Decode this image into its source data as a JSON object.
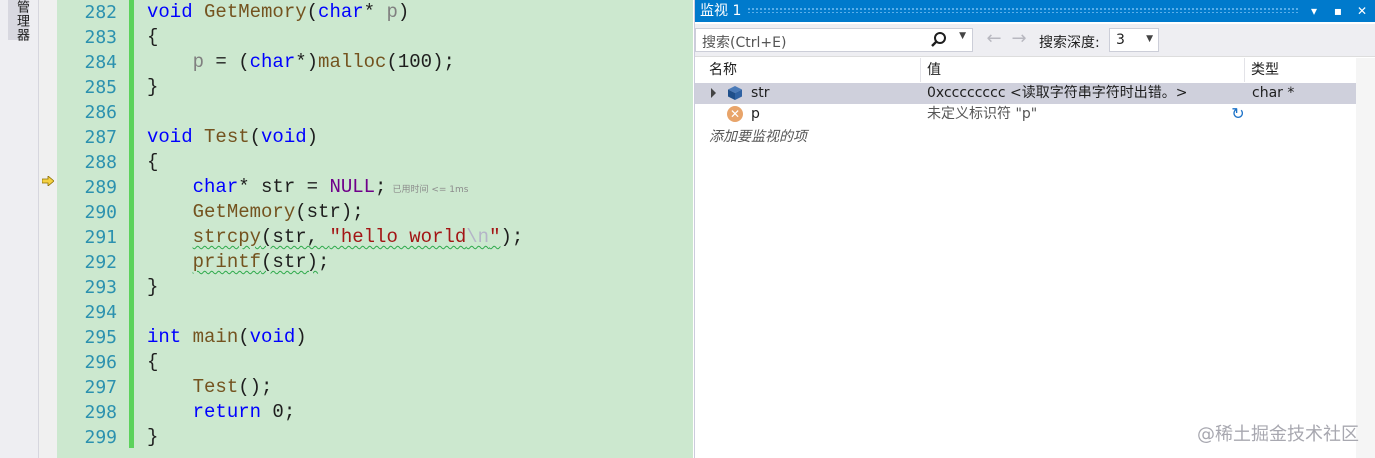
{
  "side_tab": {
    "label": "管理器"
  },
  "editor": {
    "line_numbers": [
      "282",
      "283",
      "284",
      "285",
      "286",
      "287",
      "288",
      "289",
      "290",
      "291",
      "292",
      "293",
      "294",
      "295",
      "296",
      "297",
      "298",
      "299"
    ],
    "perf_tip": "已用时间 <= 1ms",
    "current_line": "289"
  },
  "watch": {
    "title": "监视 1",
    "buttons": {
      "dropdown": "▾",
      "pin": "▪",
      "close": "✕"
    },
    "search_placeholder": "搜索(Ctrl+E)",
    "depth_label": "搜索深度:",
    "depth_value": "3",
    "columns": {
      "name": "名称",
      "value": "值",
      "type": "类型"
    },
    "rows": [
      {
        "name": "str",
        "value": "0xcccccccc <读取字符串字符时出错。>",
        "type": "char *",
        "icon": "object-icon",
        "selected": true
      },
      {
        "name": "p",
        "value": "未定义标识符 \"p\"",
        "type": "",
        "icon": "error-icon",
        "selected": false
      }
    ],
    "add_hint": "添加要监视的项"
  },
  "watermark": "@稀土掘金技术社区",
  "colors": {
    "accent": "#007acc",
    "editor_bg": "#cce8cf",
    "change_bar": "#5bd25b",
    "keyword": "#0000ff",
    "string": "#a31515"
  }
}
